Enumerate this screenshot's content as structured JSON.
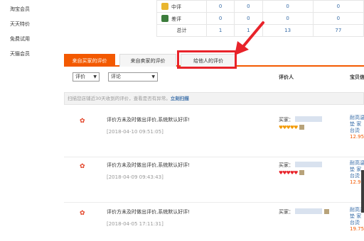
{
  "sidebar": {
    "items": [
      "淘宝会员",
      "天天特价",
      "免费试用",
      "天猫会员"
    ]
  },
  "summary": {
    "rows": [
      {
        "label": "中评",
        "values": [
          "0",
          "0",
          "0",
          "0"
        ]
      },
      {
        "label": "差评",
        "values": [
          "0",
          "0",
          "0",
          "0"
        ]
      },
      {
        "label": "总计",
        "values": [
          "1",
          "1",
          "13",
          "77"
        ]
      }
    ]
  },
  "tabs": [
    "来自买家的评价",
    "来自卖家的评价",
    "给他人的评价"
  ],
  "filters": {
    "select1": "评价",
    "select2": "评论",
    "col_rater": "评价人",
    "col_item": "宝贝信"
  },
  "notice": {
    "text": "扫描您店铺近30天收到的评价，查看是否有异常。",
    "link": "立刻扫描"
  },
  "reviews": [
    {
      "comment": "评价方未及时做出评价,系统默认好评!",
      "date": "[2018-04-10 09:51:05]",
      "buyer": "买家：",
      "hearts": "♥♥♥♥♥",
      "item": [
        "耐高温",
        "垫 家",
        "台烫",
        "12.95"
      ]
    },
    {
      "comment": "评价方未及时做出评价,系统默认好评!",
      "date": "[2018-04-09 09:43:43]",
      "buyer": "买家：",
      "hearts": "♥♥♥♥♥",
      "item": [
        "耐高温",
        "垫 家",
        "台烫",
        "12.95"
      ]
    },
    {
      "comment": "评价方未及时做出评价,系统默认好评!",
      "date": "[2018-04-05 17:11:31]",
      "buyer": "买家：",
      "hearts": "",
      "item": [
        "耐高温",
        "垫 家",
        "台烫",
        "19.75"
      ]
    }
  ],
  "colors": {
    "accent": "#f35900",
    "highlight": "#e8232a",
    "link": "#3a6ea8"
  }
}
